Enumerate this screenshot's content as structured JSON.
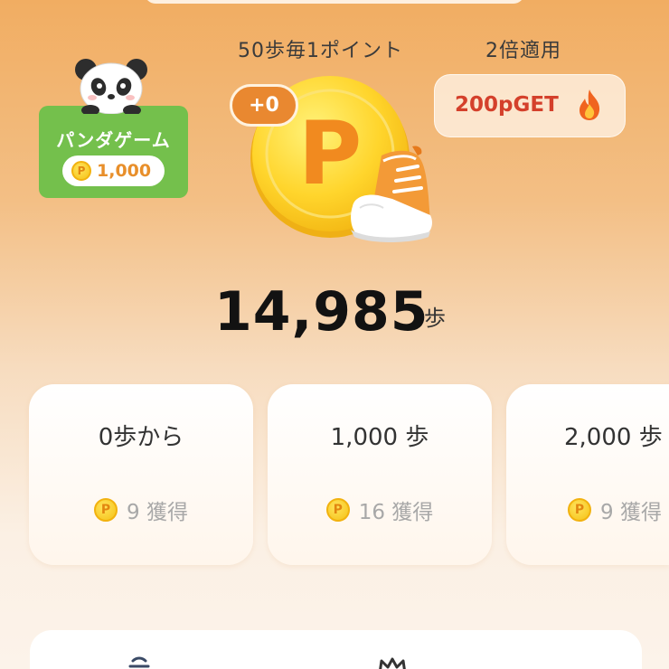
{
  "panda_game": {
    "title": "パンダゲーム",
    "points": "1,000"
  },
  "rule": {
    "per_steps": "50歩毎1ポイント",
    "multiplier": "2倍適用",
    "bonus": "200pGET"
  },
  "coin": {
    "gained": "+0",
    "letter": "P"
  },
  "steps": {
    "count": "14,985",
    "unit": "歩"
  },
  "milestones": [
    {
      "label": "0歩から",
      "reward": "9 獲得"
    },
    {
      "label": "1,000 歩",
      "reward": "16 獲得"
    },
    {
      "label": "2,000 歩",
      "reward": "9 獲得"
    }
  ],
  "coin_symbol": "P",
  "colors": {
    "accent": "#e98830",
    "panda_green": "#74c04c",
    "bonus_red": "#d4402b",
    "coin_gold": "#f5c116"
  }
}
